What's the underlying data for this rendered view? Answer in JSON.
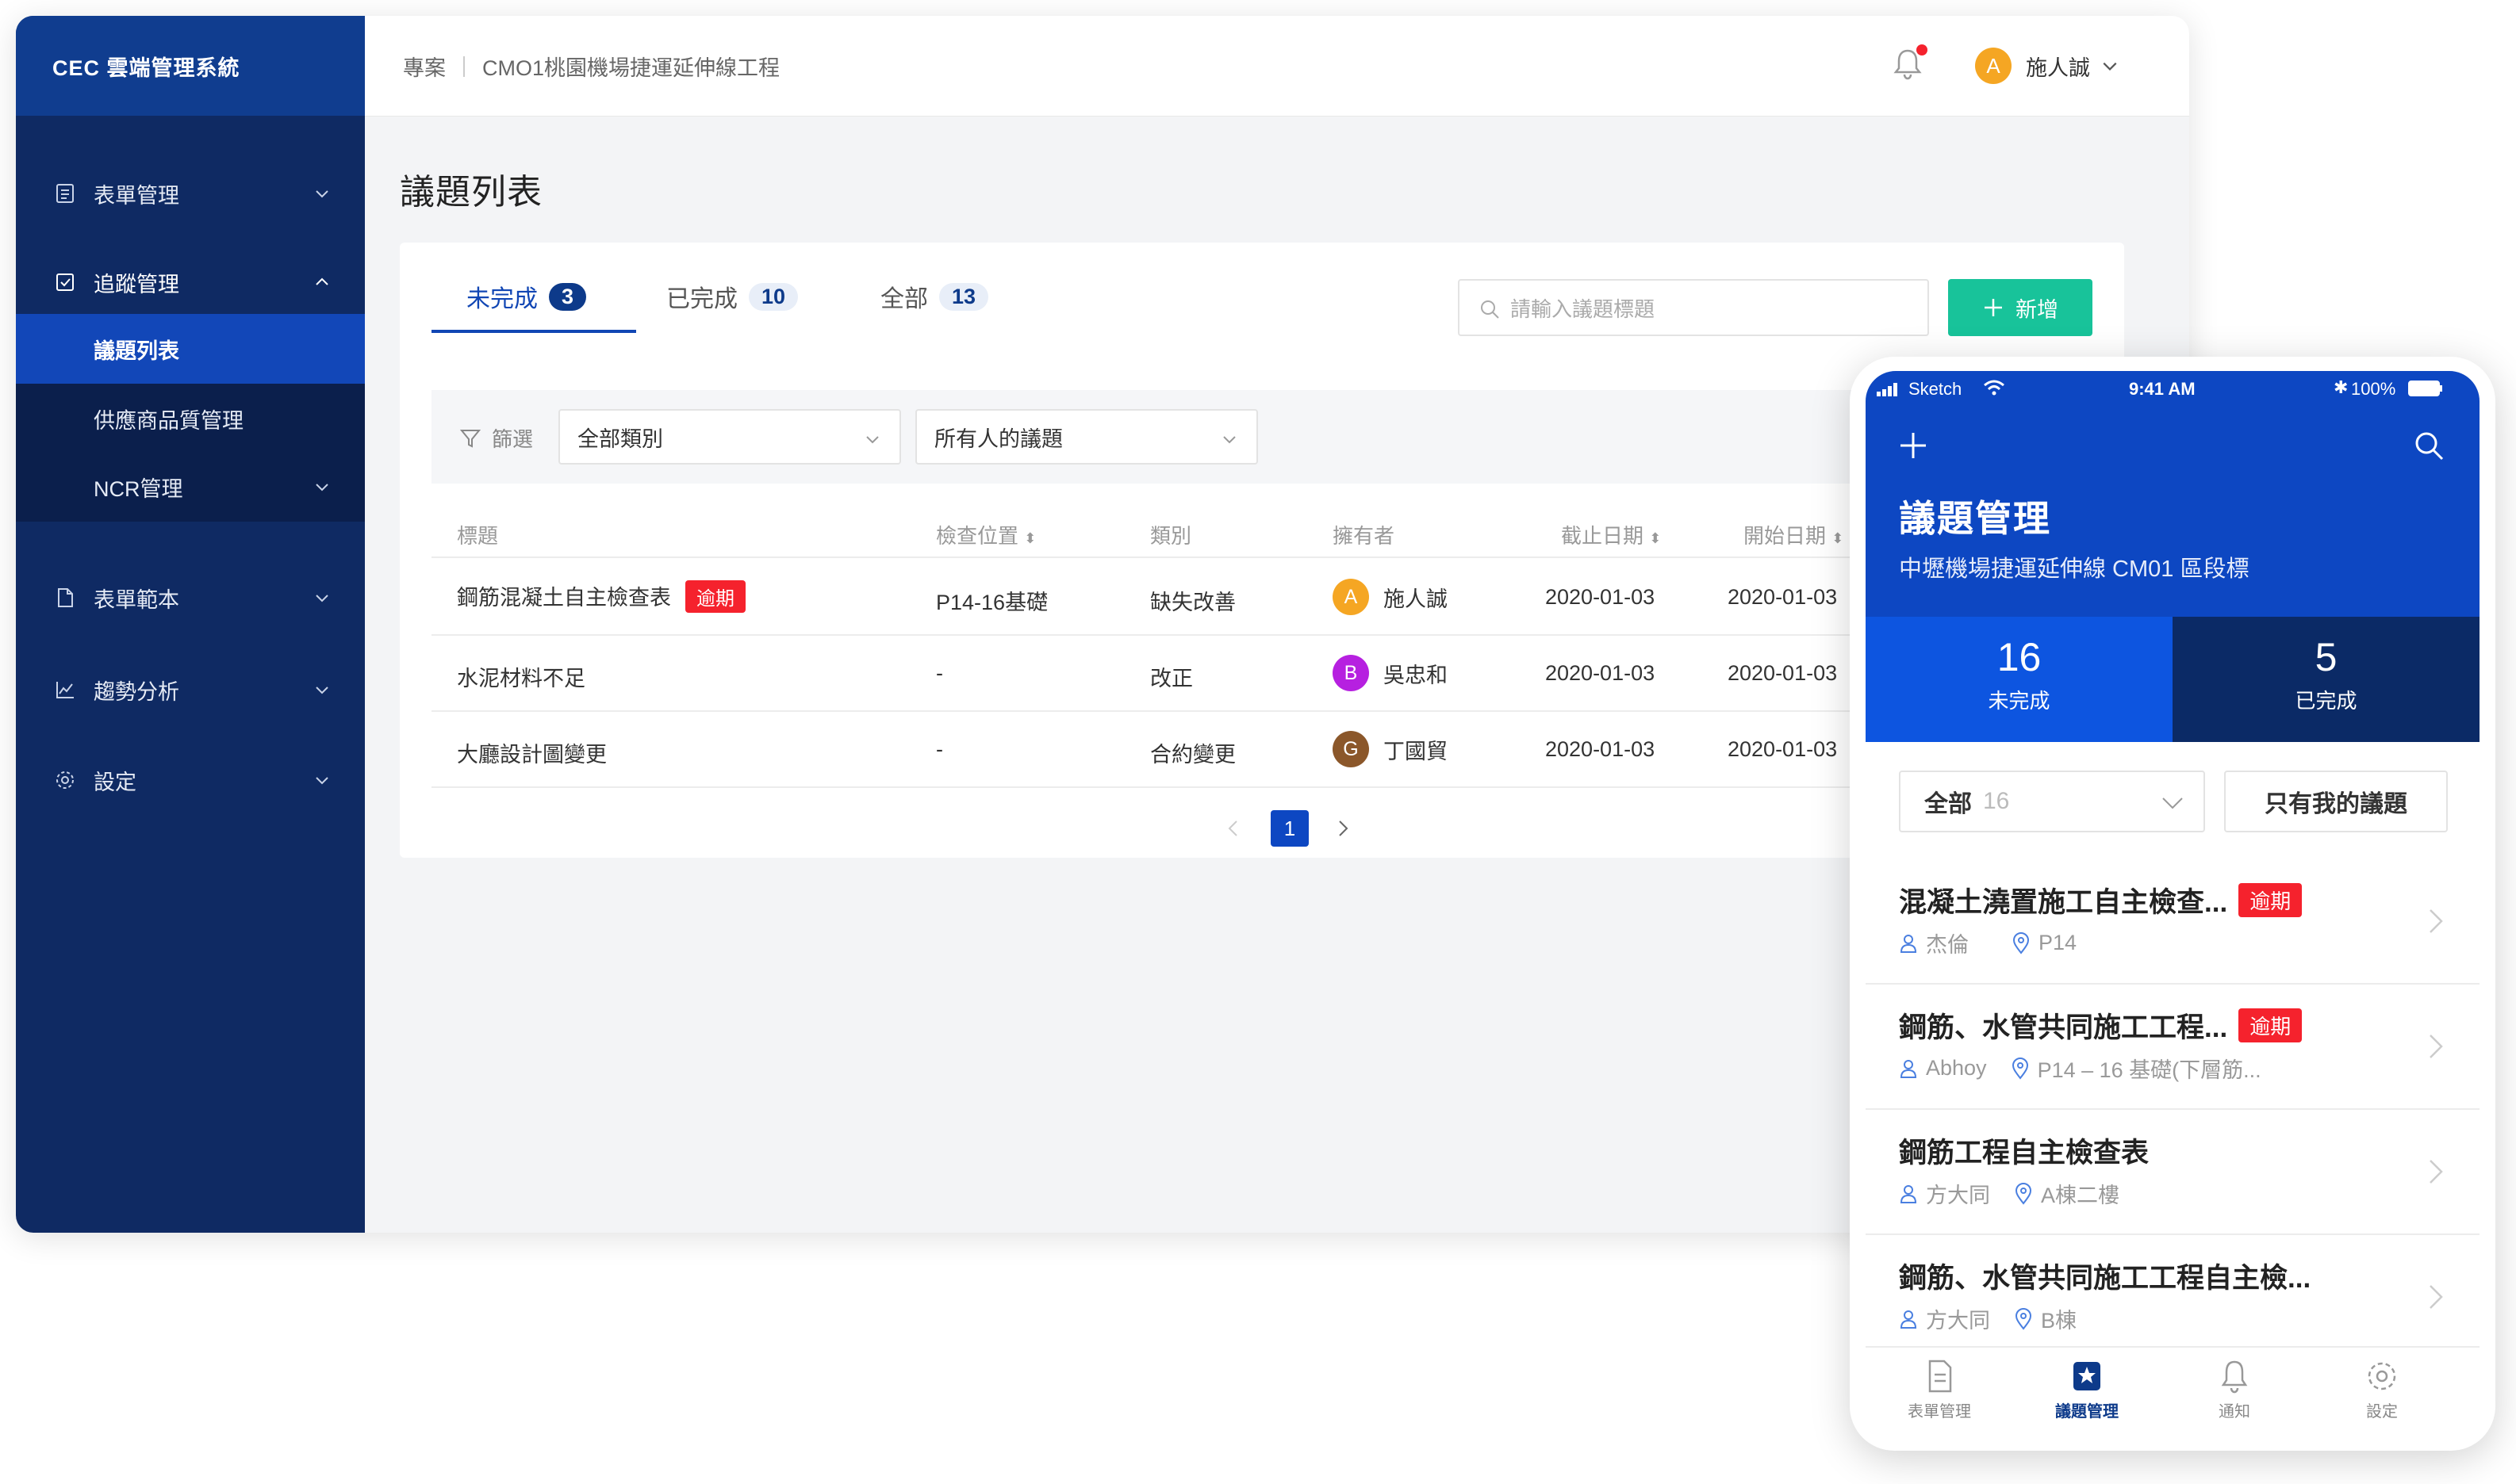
{
  "app": {
    "title": "CEC 雲端管理系統"
  },
  "sidebar": {
    "items": [
      {
        "label": "表單管理"
      },
      {
        "label": "追蹤管理"
      },
      {
        "label": "表單範本"
      },
      {
        "label": "趨勢分析"
      },
      {
        "label": "設定"
      }
    ],
    "sub": [
      {
        "label": "議題列表"
      },
      {
        "label": "供應商品質管理"
      },
      {
        "label": "NCR管理"
      }
    ]
  },
  "header": {
    "breadcrumb": [
      "專案",
      "CMO1桃園機場捷運延伸線工程"
    ],
    "user": {
      "initial": "A",
      "name": "施人誠"
    }
  },
  "page": {
    "title": "議題列表"
  },
  "tabs": [
    {
      "label": "未完成",
      "count": "3"
    },
    {
      "label": "已完成",
      "count": "10"
    },
    {
      "label": "全部",
      "count": "13"
    }
  ],
  "search": {
    "placeholder": "請輸入議題標題"
  },
  "add_button": "新增",
  "filter": {
    "label": "篩選",
    "category": "全部類別",
    "owner": "所有人的議題"
  },
  "table": {
    "columns": [
      "標題",
      "檢查位置",
      "類別",
      "擁有者",
      "截止日期",
      "開始日期"
    ],
    "rows": [
      {
        "title": "鋼筋混凝土自主檢查表",
        "tag": "逾期",
        "location": "P14-16基礎",
        "category": "缺失改善",
        "owner_initial": "A",
        "owner": "施人誠",
        "due": "2020-01-03",
        "start": "2020-01-03"
      },
      {
        "title": "水泥材料不足",
        "tag": "",
        "location": "-",
        "category": "改正",
        "owner_initial": "B",
        "owner": "吳忠和",
        "due": "2020-01-03",
        "start": "2020-01-03"
      },
      {
        "title": "大廳設計圖變更",
        "tag": "",
        "location": "-",
        "category": "合約變更",
        "owner_initial": "G",
        "owner": "丁國貿",
        "due": "2020-01-03",
        "start": "2020-01-03"
      }
    ]
  },
  "pagination": {
    "current": "1"
  },
  "colors": {
    "owner_a": "#f5a623",
    "owner_b": "#b620e0",
    "owner_g": "#8b572a",
    "brand": "#0d47c2",
    "accent": "#18c39a",
    "overdue": "#f5222d"
  },
  "phone": {
    "status": {
      "carrier": "Sketch",
      "time": "9:41 AM",
      "battery": "100%"
    },
    "title": "議題管理",
    "subtitle": "中壢機場捷運延伸線 CM01 區段標",
    "stats": [
      {
        "num": "16",
        "label": "未完成"
      },
      {
        "num": "5",
        "label": "已完成"
      }
    ],
    "filter": {
      "label": "全部",
      "count": "16"
    },
    "mine_button": "只有我的議題",
    "items": [
      {
        "title": "混凝土澆置施工自主檢查...",
        "tag": "逾期",
        "person": "杰倫",
        "location": "P14"
      },
      {
        "title": "鋼筋、水管共同施工工程...",
        "tag": "逾期",
        "person": "Abhoy",
        "location": "P14 – 16 基礎(下層筋..."
      },
      {
        "title": "鋼筋工程自主檢查表",
        "tag": "",
        "person": "方大同",
        "location": "A棟二樓"
      },
      {
        "title": "鋼筋、水管共同施工工程自主檢...",
        "tag": "",
        "person": "方大同",
        "location": "B棟"
      }
    ],
    "tabbar": [
      {
        "label": "表單管理"
      },
      {
        "label": "議題管理"
      },
      {
        "label": "通知"
      },
      {
        "label": "設定"
      }
    ]
  }
}
